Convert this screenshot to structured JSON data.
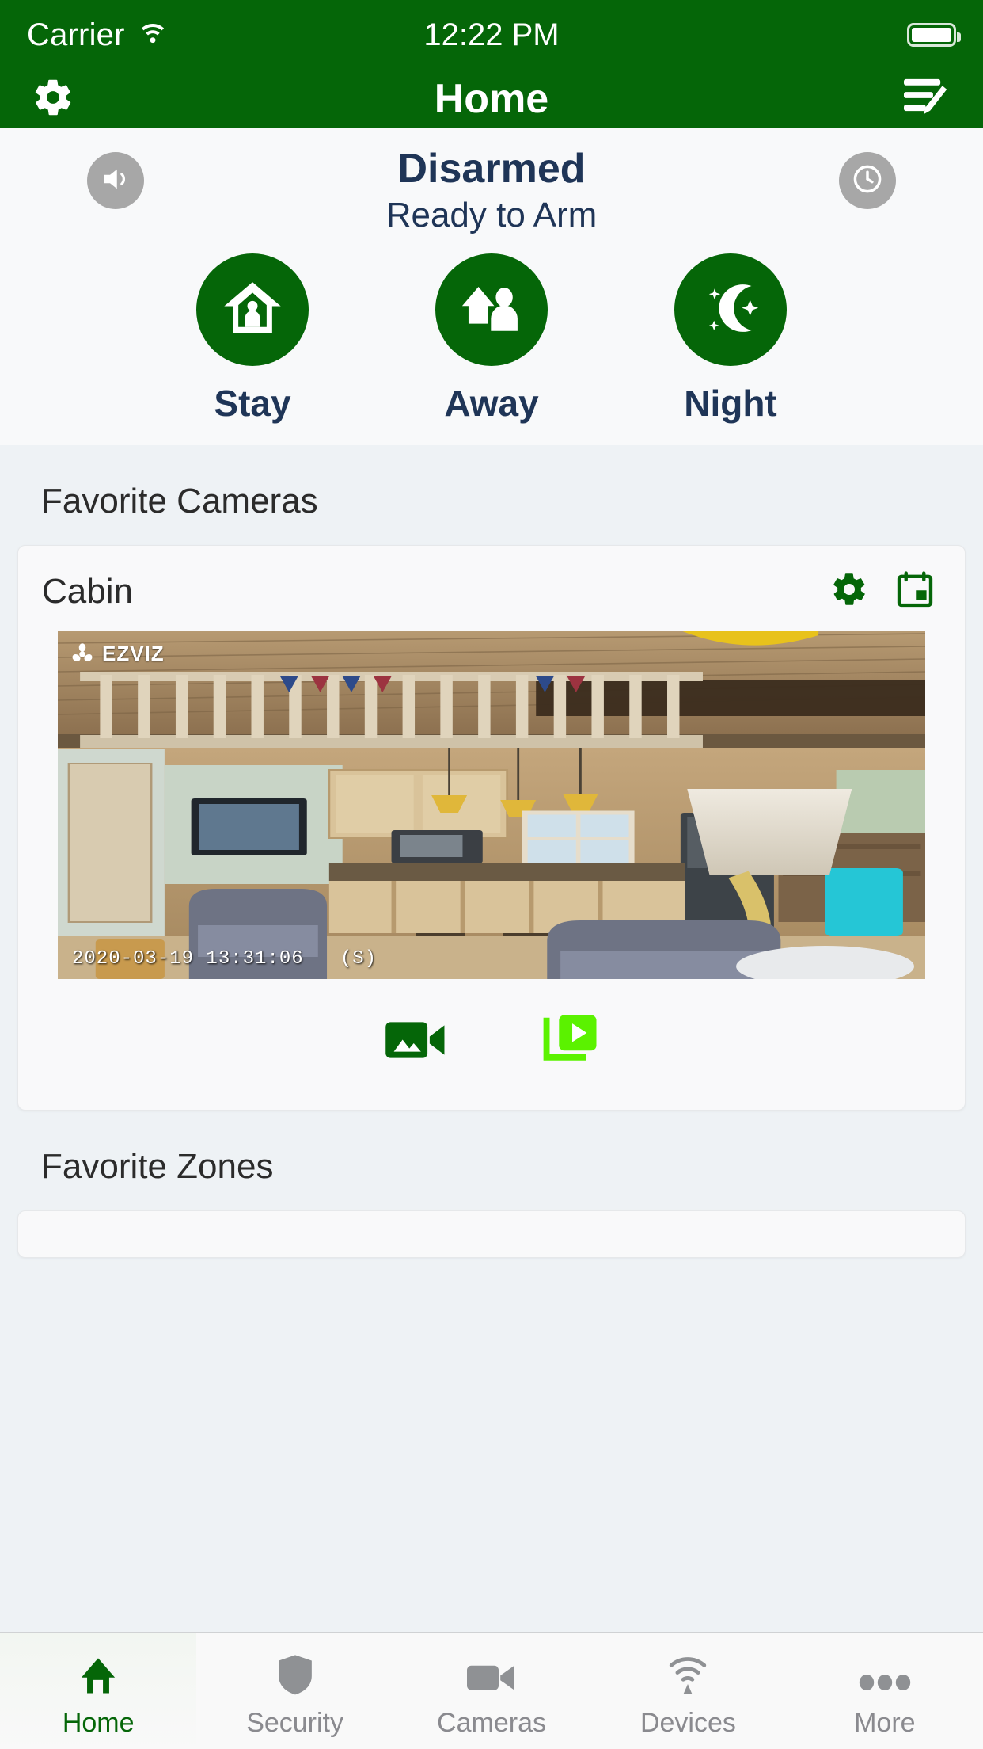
{
  "status_bar": {
    "carrier": "Carrier",
    "wifi_icon": "wifi-icon",
    "time": "12:22 PM",
    "battery_icon": "battery-full-icon"
  },
  "nav_bar": {
    "title": "Home",
    "left_icon": "gear-icon",
    "right_icon": "edit-list-icon"
  },
  "security_panel": {
    "sound_icon": "speaker-icon",
    "history_icon": "clock-icon",
    "status": "Disarmed",
    "substatus": "Ready to Arm",
    "modes": [
      {
        "label": "Stay",
        "icon": "house-person-icon"
      },
      {
        "label": "Away",
        "icon": "house-arrow-person-icon"
      },
      {
        "label": "Night",
        "icon": "moon-stars-icon"
      }
    ],
    "accent_color": "#056608",
    "text_color": "#1f3557",
    "inactive_icon_color": "#a7a7a7"
  },
  "favorite_cameras": {
    "section_title": "Favorite Cameras",
    "cameras": [
      {
        "name": "Cabin",
        "settings_icon": "gear-icon",
        "calendar_icon": "calendar-icon",
        "brand_overlay": "EZVIZ",
        "timestamp_overlay": "2020-03-19 13:31:06   (S)",
        "actions": [
          {
            "icon": "video-snapshot-icon",
            "color": "#056608"
          },
          {
            "icon": "clips-play-icon",
            "color": "#5bf200"
          }
        ]
      }
    ]
  },
  "favorite_zones": {
    "section_title": "Favorite Zones"
  },
  "tab_bar": {
    "tabs": [
      {
        "label": "Home",
        "icon": "home-icon",
        "active": true
      },
      {
        "label": "Security",
        "icon": "shield-icon",
        "active": false
      },
      {
        "label": "Cameras",
        "icon": "video-camera-icon",
        "active": false
      },
      {
        "label": "Devices",
        "icon": "signal-icon",
        "active": false
      },
      {
        "label": "More",
        "icon": "ellipsis-icon",
        "active": false
      }
    ],
    "active_color": "#056608",
    "inactive_color": "#8a8a8f"
  }
}
